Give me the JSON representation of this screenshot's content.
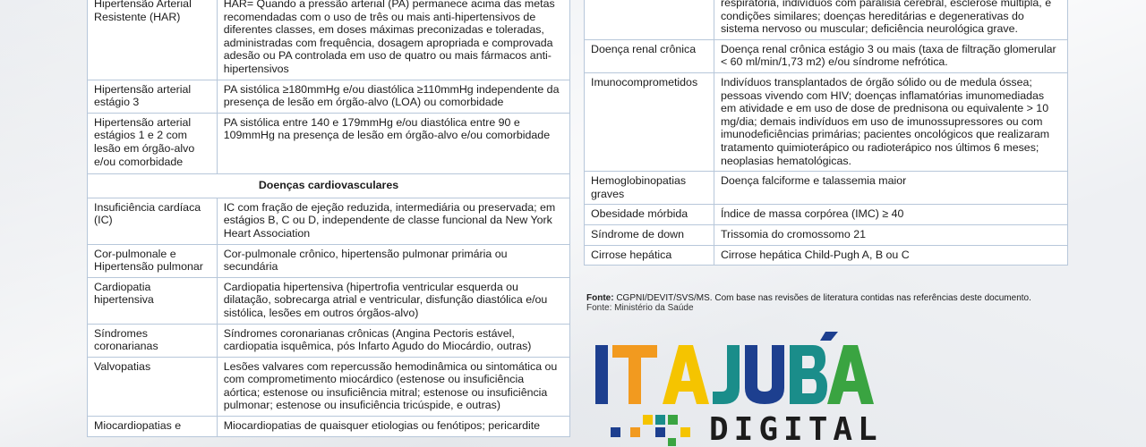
{
  "left_table": {
    "rows_top": [
      {
        "condition": "Hipertensão Arterial Resistente (HAR)",
        "criteria": "HAR= Quando a pressão arterial (PA) permanece acima das metas recomendadas com o uso de três ou mais anti-hipertensivos de diferentes classes, em doses máximas preconizadas e toleradas, administradas com frequência, dosagem apropriada e comprovada adesão ou PA controlada em uso de quatro ou mais fármacos anti-hipertensivos"
      },
      {
        "condition": "Hipertensão arterial estágio 3",
        "criteria": "PA sistólica ≥180mmHg e/ou diastólica ≥110mmHg independente da presença de lesão em órgão-alvo (LOA) ou comorbidade"
      },
      {
        "condition": "Hipertensão arterial estágios 1 e 2 com lesão em órgão-alvo e/ou comorbidade",
        "criteria": "PA sistólica entre 140 e 179mmHg e/ou diastólica entre 90 e 109mmHg na presença de lesão em órgão-alvo e/ou comorbidade"
      }
    ],
    "section_title": "Doenças cardiovasculares",
    "rows_bottom": [
      {
        "condition": "Insuficiência cardíaca (IC)",
        "criteria": "IC com fração de ejeção reduzida, intermediária ou preservada; em estágios B, C ou D, independente de classe funcional da New York Heart Association"
      },
      {
        "condition": "Cor-pulmonale e Hipertensão pulmonar",
        "criteria": "Cor-pulmonale crônico, hipertensão pulmonar primária ou secundária"
      },
      {
        "condition": "Cardiopatia hipertensiva",
        "criteria": "Cardiopatia hipertensiva (hipertrofia ventricular esquerda ou dilatação, sobrecarga atrial e ventricular, disfunção diastólica e/ou sistólica, lesões em outros órgãos-alvo)"
      },
      {
        "condition": "Síndromes coronarianas",
        "criteria": "Síndromes coronarianas crônicas (Angina Pectoris estável, cardiopatia isquêmica, pós Infarto Agudo do Miocárdio, outras)"
      },
      {
        "condition": "Valvopatias",
        "criteria": "Lesões valvares com repercussão hemodinâmica ou sintomática ou com comprometimento miocárdico (estenose ou insuficiência aórtica; estenose ou insuficiência mitral; estenose ou insuficiência pulmonar; estenose ou insuficiência tricúspide, e outras)"
      },
      {
        "condition": "Miocardiopatias e",
        "criteria": "Miocardiopatias de quaisquer etiologias ou fenótipos; pericardite"
      }
    ]
  },
  "right_table": {
    "rows": [
      {
        "condition": "",
        "criteria": "respiratória, indivíduos com paralisia cerebral, esclerose múltipla, e condições similares; doenças hereditárias e degenerativas do sistema nervoso ou muscular; deficiência neurológica grave."
      },
      {
        "condition": "Doença renal crônica",
        "criteria": "Doença renal crônica estágio 3 ou mais (taxa de filtração glomerular < 60 ml/min/1,73 m2) e/ou síndrome nefrótica."
      },
      {
        "condition": "Imunocomprometidos",
        "criteria": "Indivíduos transplantados de órgão sólido ou de medula óssea; pessoas vivendo com HIV; doenças inflamatórias imunomediadas em atividade e em uso de dose de prednisona ou equivalente > 10 mg/dia; demais indivíduos em uso de imunossupressores ou com imunodeficiências primárias; pacientes oncológicos que realizaram tratamento quimioterápico ou radioterápico nos últimos 6 meses; neoplasias hematológicas."
      },
      {
        "condition": "Hemoglobinopatias graves",
        "criteria": "Doença falciforme e talassemia maior"
      },
      {
        "condition": "Obesidade mórbida",
        "criteria": "Índice de massa corpórea (IMC) ≥ 40"
      },
      {
        "condition": "Síndrome de down",
        "criteria": "Trissomia do cromossomo 21"
      },
      {
        "condition": "Cirrose hepática",
        "criteria": "Cirrose hepática Child-Pugh A, B ou C"
      }
    ]
  },
  "source": {
    "label": "Fonte:",
    "text": "CGPNI/DEVIT/SVS/MS. Com base nas revisões de literatura contidas nas referências deste documento.",
    "line2": "Fonte: Ministério da Saúde"
  },
  "logo": {
    "word_top": "ITAJUBÁ",
    "word_bottom": "DIGITAL",
    "colors": {
      "blue": "#1d3f8f",
      "orange": "#f29a1f",
      "yellow": "#f5c400",
      "teal": "#1a8d8a",
      "green": "#3aa441",
      "dark": "#1c1c1c"
    }
  }
}
